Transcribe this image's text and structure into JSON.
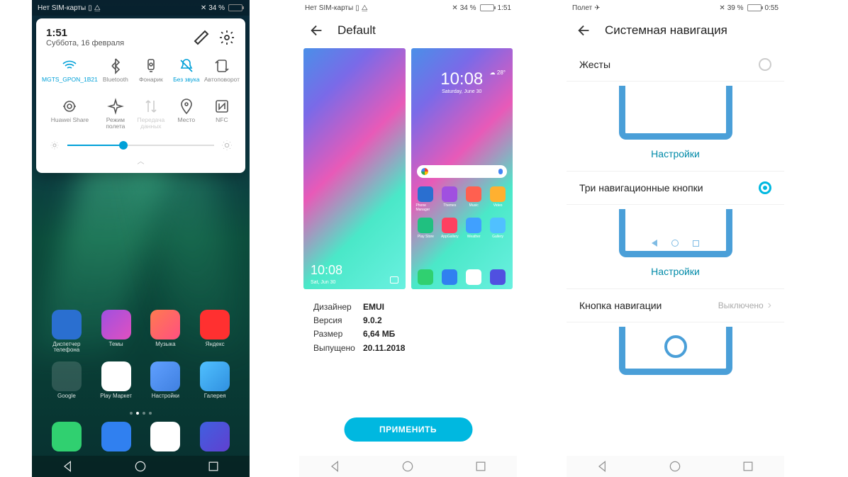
{
  "phone1": {
    "status": {
      "carrier": "Нет SIM-карты",
      "battery_pct": "34 %",
      "battery_fill": 34
    },
    "qs": {
      "time": "1:51",
      "date": "Суббота, 16 февраля",
      "tiles": [
        {
          "label": "MGTS_GPON_1B21",
          "active": true,
          "icon": "wifi"
        },
        {
          "label": "Bluetooth",
          "icon": "bt"
        },
        {
          "label": "Фонарик",
          "icon": "flash"
        },
        {
          "label": "Без звука",
          "active": true,
          "icon": "mute"
        },
        {
          "label": "Автоповорот",
          "icon": "rotate"
        },
        {
          "label": "Huawei Share",
          "icon": "share"
        },
        {
          "label": "Режим полета",
          "icon": "plane"
        },
        {
          "label": "Передача данных",
          "dim": true,
          "icon": "data"
        },
        {
          "label": "Место",
          "icon": "location"
        },
        {
          "label": "NFC",
          "icon": "nfc"
        }
      ],
      "brightness": 38
    },
    "apps_row1": [
      {
        "label": "Диспетчер телефона",
        "bg": "#2a6fd0"
      },
      {
        "label": "Темы",
        "bg": "linear-gradient(135deg,#a050e0,#e050c0)"
      },
      {
        "label": "Музыка",
        "bg": "linear-gradient(135deg,#ff7a50,#ff5080)"
      },
      {
        "label": "Яндекс",
        "bg": "#ff3030"
      }
    ],
    "apps_row2": [
      {
        "label": "Google",
        "bg": "rgba(255,255,255,.15)"
      },
      {
        "label": "Play Маркет",
        "bg": "#fff"
      },
      {
        "label": "Настройки",
        "bg": "linear-gradient(135deg,#60a0ff,#4080e0)"
      },
      {
        "label": "Галерея",
        "bg": "linear-gradient(135deg,#50c0ff,#3090e0)"
      }
    ],
    "dock": [
      {
        "bg": "#30d070"
      },
      {
        "bg": "#3080f0"
      },
      {
        "bg": "#fff"
      },
      {
        "bg": "linear-gradient(135deg,#4060e0,#6040d0)"
      }
    ]
  },
  "phone2": {
    "status": {
      "carrier": "Нет SIM-карты",
      "battery_pct": "34 %",
      "time": "1:51",
      "battery_fill": 34
    },
    "title": "Default",
    "preview": {
      "lock_time": "10:08",
      "lock_date": "Sat, Jun 30",
      "home_time": "10:08",
      "home_date": "Saturday, June 30",
      "weather_temp": "28°"
    },
    "info": [
      {
        "k": "Дизайнер",
        "v": "EMUI"
      },
      {
        "k": "Версия",
        "v": "9.0.2"
      },
      {
        "k": "Размер",
        "v": "6,64 МБ"
      },
      {
        "k": "Выпущено",
        "v": "20.11.2018"
      }
    ],
    "apply": "ПРИМЕНИТЬ",
    "pv_apps": [
      "Phone Manager",
      "Themes",
      "Music",
      "Video",
      "Play Store",
      "AppGallery",
      "Weather",
      "Gallery"
    ]
  },
  "phone3": {
    "status": {
      "carrier": "Полет",
      "battery_pct": "39 %",
      "time": "0:55",
      "battery_fill": 39
    },
    "title": "Системная навигация",
    "opt_gestures": "Жесты",
    "opt_three": "Три навигационные кнопки",
    "opt_single": "Кнопка навигации",
    "opt_single_val": "Выключено",
    "settings_link": "Настройки"
  }
}
